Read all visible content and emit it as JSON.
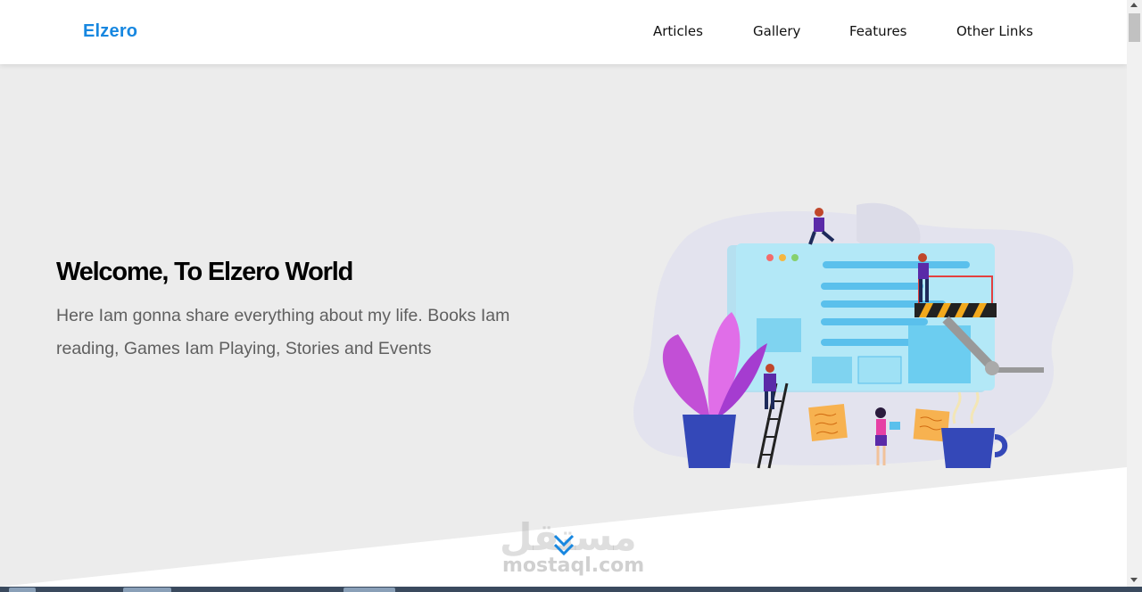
{
  "header": {
    "logo": "Elzero",
    "nav": [
      "Articles",
      "Gallery",
      "Features",
      "Other Links"
    ]
  },
  "hero": {
    "title": "Welcome, To Elzero World",
    "text": "Here Iam gonna share everything about my life. Books Iam reading, Games Iam Playing, Stories and Events"
  },
  "watermark": {
    "arabic": "مستقل",
    "latin": "mostaql.com"
  },
  "colors": {
    "brand": "#1787e0",
    "hero_bg": "#ececec",
    "title": "#000000",
    "text": "#5f5f5f"
  },
  "icons": {
    "scroll_down": "double-chevron-down-icon",
    "illustration": "web-design-team-illustration"
  }
}
